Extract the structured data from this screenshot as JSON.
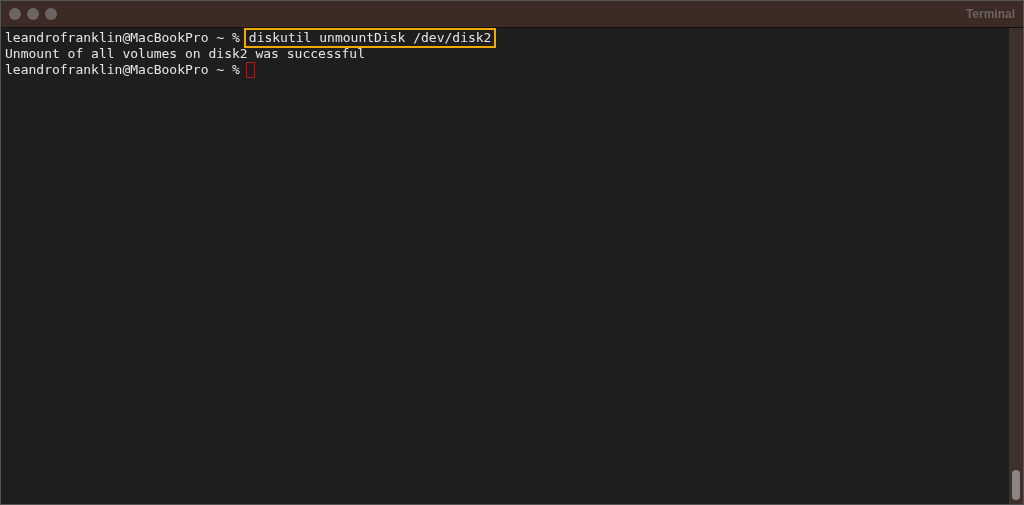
{
  "window": {
    "title": "Terminal"
  },
  "lines": [
    {
      "kind": "command",
      "prompt": "leandrofranklin@MacBookPro ~ %",
      "command": "diskutil unmountDisk /dev/disk2",
      "highlighted": true
    },
    {
      "kind": "output",
      "text": "Unmount of all volumes on disk2 was successful"
    },
    {
      "kind": "cursor",
      "prompt": "leandrofranklin@MacBookPro ~ %"
    }
  ]
}
